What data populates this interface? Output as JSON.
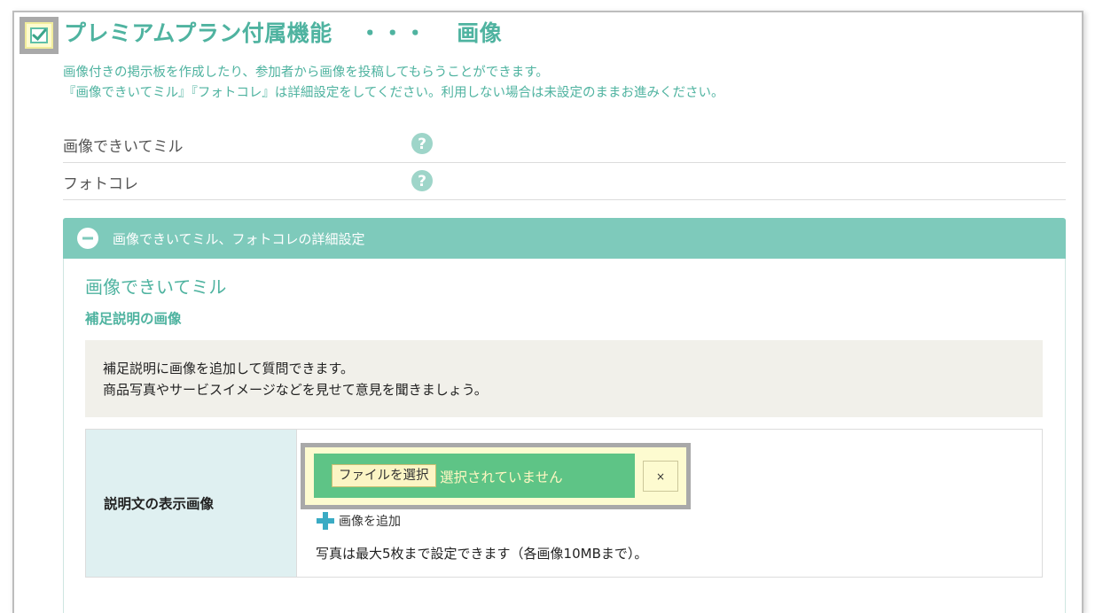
{
  "header": {
    "title": "プレミアムプラン付属機能",
    "dots": "・・・",
    "subtitle": "画像",
    "enabled": true
  },
  "description": {
    "line1": "画像付きの掲示板を作成したり、参加者から画像を投稿してもらうことができます。",
    "line2": "『画像できいてミル』『フォトコレ』は詳細設定をしてください。利用しない場合は未設定のままお進みください。"
  },
  "options": [
    {
      "label": "画像できいてミル",
      "icon": "help-icon"
    },
    {
      "label": "フォトコレ",
      "icon": "help-icon"
    }
  ],
  "panel": {
    "header_label": "画像できいてミル、フォトコレの詳細設定",
    "header_icon": "minus-circle-icon",
    "section_title": "画像できいてミル",
    "sub_title": "補足説明の画像",
    "info_line1": "補足説明に画像を追加して質問できます。",
    "info_line2": "商品写真やサービスイメージなどを見せて意見を聞きましょう。",
    "row_label": "説明文の表示画像",
    "file_button": "ファイルを選択",
    "file_status": "選択されていません",
    "remove_label": "×",
    "add_image_label": "画像を追加",
    "note": "写真は最大5枚まで設定できます（各画像10MBまで）。"
  },
  "colors": {
    "accent": "#4fb3a0",
    "panel_header": "#7ecabb",
    "file_bar": "#5ec486",
    "highlight": "#fdfbd0"
  }
}
